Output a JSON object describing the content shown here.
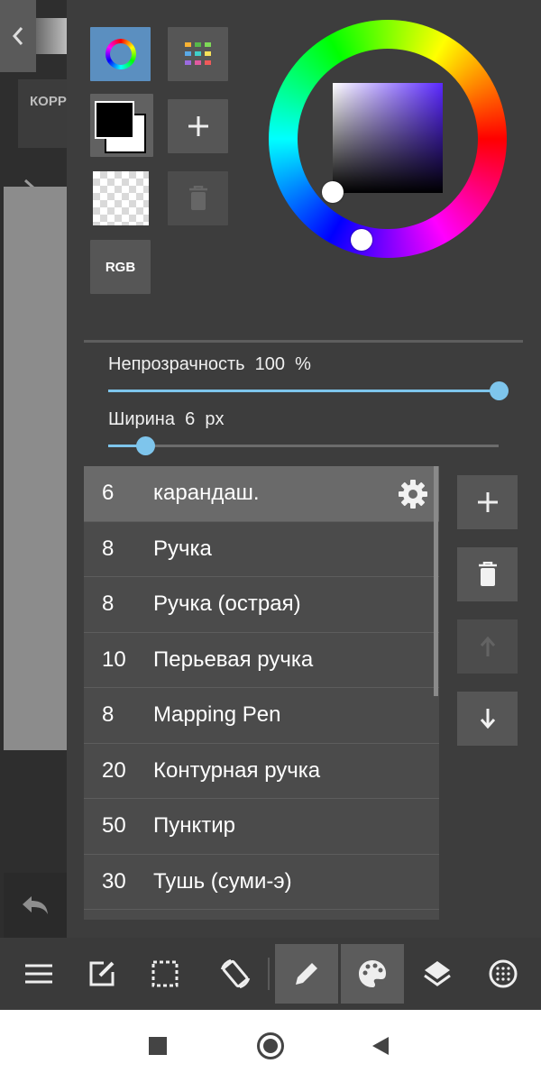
{
  "left_panel": {
    "correction_label": "КОРР",
    "icons": {
      "back": "chevron-left-icon",
      "expand": "chevron-right-icon",
      "undo": "undo-icon"
    }
  },
  "color_panel": {
    "rgb_label": "RGB",
    "icons": {
      "wheel_mode": "color-wheel-icon",
      "swatches": "palette-grid-icon",
      "add_color": "plus-icon",
      "delete_color": "trash-icon"
    },
    "colors": {
      "foreground": "#000000",
      "background": "#ffffff",
      "accent": "#5b8fc0",
      "selected_hue": "#5a28ff"
    }
  },
  "sliders": {
    "opacity": {
      "label": "Непрозрачность  100  %",
      "value": 100,
      "max": 100
    },
    "width": {
      "label": "Ширина  6  px",
      "value": 6
    }
  },
  "brushes": [
    {
      "size": "6",
      "name": "карандаш.",
      "selected": true
    },
    {
      "size": "8",
      "name": "Ручка"
    },
    {
      "size": "8",
      "name": "Ручка (острая)"
    },
    {
      "size": "10",
      "name": "Перьевая ручка"
    },
    {
      "size": "8",
      "name": "Mapping Pen"
    },
    {
      "size": "20",
      "name": "Контурная ручка"
    },
    {
      "size": "50",
      "name": "Пунктир"
    },
    {
      "size": "30",
      "name": "Тушь (суми-э)"
    }
  ],
  "brush_actions": [
    "plus-icon",
    "trash-icon",
    "arrow-up-icon",
    "arrow-down-icon"
  ],
  "toolbar": {
    "items": [
      "menu-icon",
      "edit-icon",
      "selection-icon",
      "rotate-icon",
      "pen-icon",
      "palette-icon",
      "layers-icon",
      "material-icon"
    ],
    "active": [
      "pen-icon",
      "palette-icon"
    ]
  },
  "system_nav": [
    "recents-icon",
    "home-icon",
    "back-icon"
  ]
}
